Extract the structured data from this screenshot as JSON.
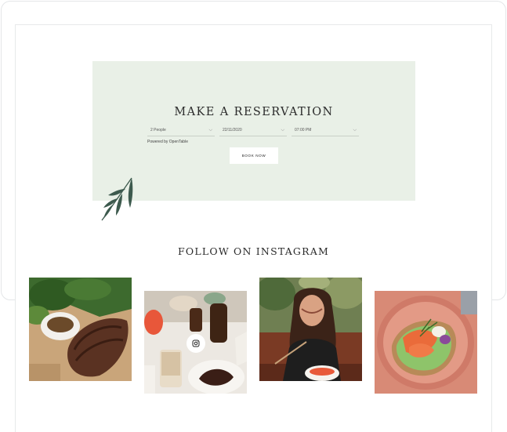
{
  "reservation": {
    "title": "MAKE A RESERVATION",
    "people": "2 People",
    "date": "22/11/2020",
    "time": "07:00 PM",
    "powered_by": "Powered by OpenTable",
    "book_label": "BOOK NOW",
    "chevron": "⌵"
  },
  "instagram": {
    "title": "FOLLOW ON INSTAGRAM",
    "photos": [
      {
        "subject": "steak-with-salad"
      },
      {
        "subject": "drinks-and-dessert"
      },
      {
        "subject": "woman-eating-salad"
      },
      {
        "subject": "salmon-avocado-toast"
      }
    ]
  },
  "colors": {
    "reservation_bg": "#e9f0e7",
    "leaf": "#3d5a4e",
    "text": "#2b2b2b"
  }
}
